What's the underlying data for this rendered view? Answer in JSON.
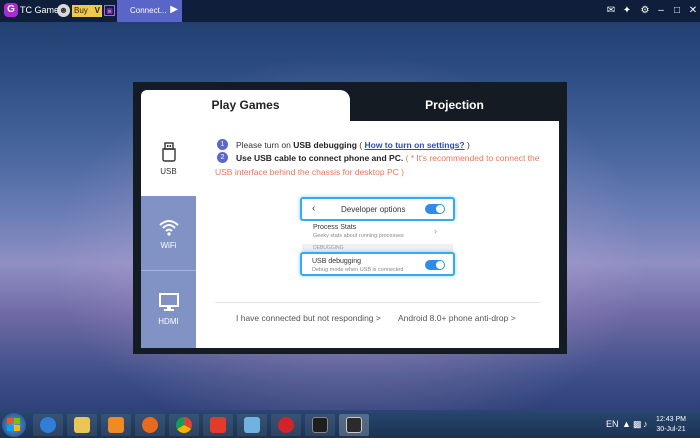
{
  "topbar": {
    "app_logo": "G",
    "app_name": "TC Games",
    "buy_label": "Buy",
    "vip_label": "V",
    "connect_tab": "Connect..."
  },
  "dialog": {
    "tabs": [
      {
        "label": "Play Games",
        "active": true
      },
      {
        "label": "Projection",
        "active": false
      }
    ],
    "sidebar": [
      {
        "label": "USB",
        "icon": "usb-icon",
        "active": true
      },
      {
        "label": "WiFi",
        "icon": "wifi-icon",
        "active": false
      },
      {
        "label": "HDMI",
        "icon": "monitor-icon",
        "active": false
      }
    ],
    "steps": [
      {
        "num": "1",
        "prefix": "Please turn on ",
        "bold": "USB debugging",
        "paren_open": " ( ",
        "link": "How to turn on settings?",
        "paren_close": " )"
      },
      {
        "num": "2",
        "bold": "Use USB cable to connect phone and PC.",
        "warning_line1": " ( * It's recommended to connect the",
        "warning_line2": "USB interface behind the chassis for desktop PC )"
      }
    ],
    "illustration": {
      "back": "‹",
      "developer_options": "Developer options",
      "process_stats": "Process Stats",
      "process_stats_sub": "Geeky stats about running processes",
      "section_header": "DEBUGGING",
      "usb_debugging": "USB debugging",
      "usb_debugging_sub": "Debug mode when USB is connected",
      "chevron": "›"
    },
    "footer_links": [
      "I have connected but not responding >",
      "Android 8.0+ phone anti-drop >"
    ]
  },
  "taskbar": {
    "time": "12:43 PM",
    "date": "30-Jul-21",
    "lang": "EN"
  },
  "colors": {
    "accent": "#5b67c9",
    "sidebar_inactive": "#8093c4",
    "toggle_on": "#2f8ce8",
    "warning": "#e8765a"
  }
}
